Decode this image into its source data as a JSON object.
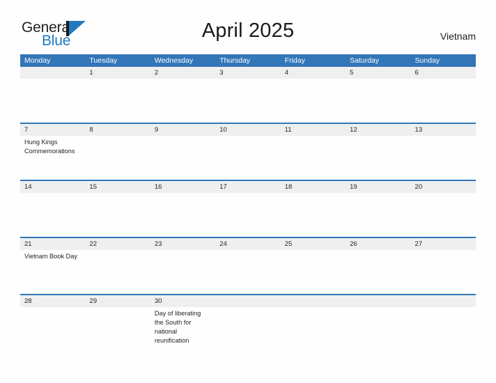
{
  "brand": {
    "name_part1": "General",
    "name_part2": "Blue",
    "accent_color": "#1f7ac0"
  },
  "header": {
    "title": "April 2025",
    "country": "Vietnam"
  },
  "theme": {
    "header_blue": "#3276b8",
    "date_band_gray": "#efefef",
    "text_color": "#231f20",
    "background": "#fefefe"
  },
  "weekdays": [
    "Monday",
    "Tuesday",
    "Wednesday",
    "Thursday",
    "Friday",
    "Saturday",
    "Sunday"
  ],
  "weeks": [
    {
      "days": [
        {
          "date": "",
          "event": ""
        },
        {
          "date": "1",
          "event": ""
        },
        {
          "date": "2",
          "event": ""
        },
        {
          "date": "3",
          "event": ""
        },
        {
          "date": "4",
          "event": ""
        },
        {
          "date": "5",
          "event": ""
        },
        {
          "date": "6",
          "event": ""
        }
      ]
    },
    {
      "days": [
        {
          "date": "7",
          "event": "Hung Kings Commemorations"
        },
        {
          "date": "8",
          "event": ""
        },
        {
          "date": "9",
          "event": ""
        },
        {
          "date": "10",
          "event": ""
        },
        {
          "date": "11",
          "event": ""
        },
        {
          "date": "12",
          "event": ""
        },
        {
          "date": "13",
          "event": ""
        }
      ]
    },
    {
      "days": [
        {
          "date": "14",
          "event": ""
        },
        {
          "date": "15",
          "event": ""
        },
        {
          "date": "16",
          "event": ""
        },
        {
          "date": "17",
          "event": ""
        },
        {
          "date": "18",
          "event": ""
        },
        {
          "date": "19",
          "event": ""
        },
        {
          "date": "20",
          "event": ""
        }
      ]
    },
    {
      "days": [
        {
          "date": "21",
          "event": "Vietnam Book Day"
        },
        {
          "date": "22",
          "event": ""
        },
        {
          "date": "23",
          "event": ""
        },
        {
          "date": "24",
          "event": ""
        },
        {
          "date": "25",
          "event": ""
        },
        {
          "date": "26",
          "event": ""
        },
        {
          "date": "27",
          "event": ""
        }
      ]
    },
    {
      "days": [
        {
          "date": "28",
          "event": ""
        },
        {
          "date": "29",
          "event": ""
        },
        {
          "date": "30",
          "event": "Day of liberating the South for national reunification"
        },
        {
          "date": "",
          "event": ""
        },
        {
          "date": "",
          "event": ""
        },
        {
          "date": "",
          "event": ""
        },
        {
          "date": "",
          "event": ""
        }
      ]
    }
  ]
}
